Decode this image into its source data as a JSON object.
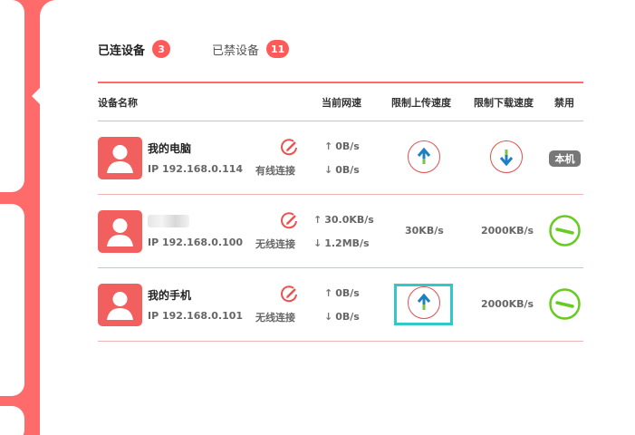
{
  "tabs": [
    {
      "label": "已连设备",
      "count": "3"
    },
    {
      "label": "已禁设备",
      "count": "11"
    }
  ],
  "columns": {
    "name": "设备名称",
    "speed": "当前网速",
    "upload": "限制上传速度",
    "download": "限制下载速度",
    "ban": "禁用"
  },
  "devices": [
    {
      "name": "我的电脑",
      "ip": "IP 192.168.0.114",
      "connection": "有线连接",
      "up": "0B/s",
      "down": "0B/s",
      "upload_limit": "",
      "download_limit": "",
      "ban_label": "本机"
    },
    {
      "name": "",
      "ip": "IP 192.168.0.100",
      "connection": "无线连接",
      "up": "30.0KB/s",
      "down": "1.2MB/s",
      "upload_limit": "30KB/s",
      "download_limit": "2000KB/s",
      "ban_label": ""
    },
    {
      "name": "我的手机",
      "ip": "IP 192.168.0.101",
      "connection": "无线连接",
      "up": "0B/s",
      "down": "0B/s",
      "upload_limit": "",
      "download_limit": "2000KB/s",
      "ban_label": ""
    }
  ],
  "colors": {
    "accent": "#ff6b6b",
    "avatar": "#f25f5f",
    "ban": "#66cc22",
    "arrow_up": "#1f7fc4",
    "arrow_down": "#1f7fc4",
    "highlight": "#33c8c8"
  },
  "icons": {
    "edit": "edit-icon",
    "upload": "upload-arrow-icon",
    "download": "download-arrow-icon",
    "ban": "ban-icon",
    "avatar": "user-avatar-icon"
  }
}
